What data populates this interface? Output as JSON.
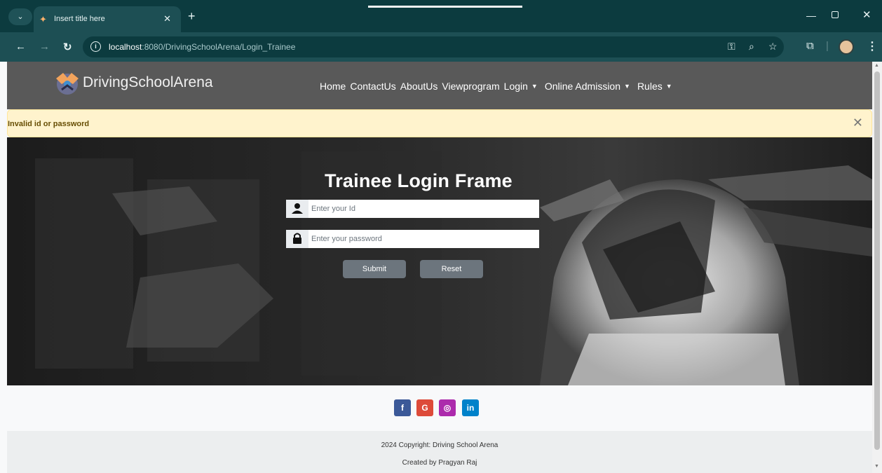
{
  "browser": {
    "tab_title": "Insert title here",
    "url_host": "localhost",
    "url_rest": ":8080/DrivingSchoolArena/Login_Trainee"
  },
  "site": {
    "brand": "DrivingSchoolArena",
    "nav": [
      {
        "label": "Home",
        "dropdown": false
      },
      {
        "label": "ContactUs",
        "dropdown": false
      },
      {
        "label": "AboutUs",
        "dropdown": false
      },
      {
        "label": "Viewprogram",
        "dropdown": false
      },
      {
        "label": "Login",
        "dropdown": true
      },
      {
        "label": "Online Admission",
        "dropdown": true
      },
      {
        "label": "Rules",
        "dropdown": true
      }
    ]
  },
  "alert": {
    "message": "Invalid id or password"
  },
  "login": {
    "title": "Trainee Login Frame",
    "id_placeholder": "Enter your Id",
    "password_placeholder": "Enter your password",
    "submit_label": "Submit",
    "reset_label": "Reset"
  },
  "social": [
    {
      "icon": "facebook-icon",
      "glyph": "f",
      "color": "#3b5998"
    },
    {
      "icon": "google-icon",
      "glyph": "G",
      "color": "#dd4b39"
    },
    {
      "icon": "instagram-icon",
      "glyph": "◎",
      "color": "#ac2bac"
    },
    {
      "icon": "linkedin-icon",
      "glyph": "in",
      "color": "#0082ca"
    }
  ],
  "footer": {
    "copyright": "2024 Copyright: Driving School Arena",
    "credit": "Created by Pragyan Raj"
  }
}
